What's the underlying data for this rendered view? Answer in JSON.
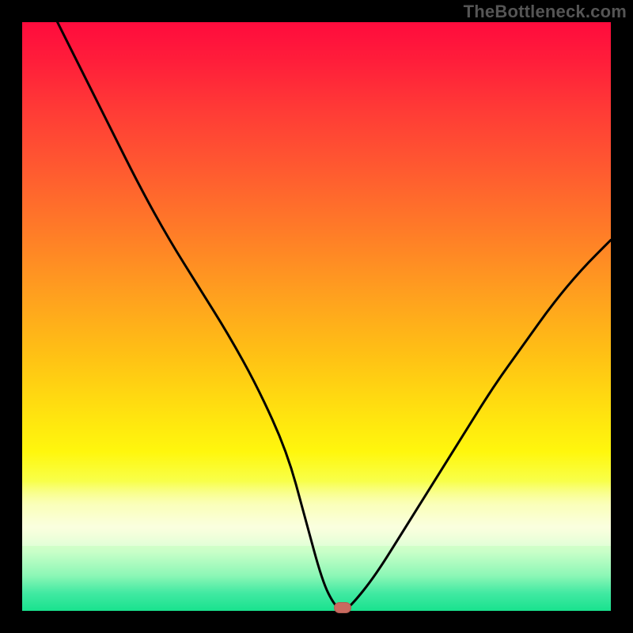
{
  "watermark": "TheBottleneck.com",
  "chart_data": {
    "type": "line",
    "title": "",
    "xlabel": "",
    "ylabel": "",
    "xlim": [
      0,
      100
    ],
    "ylim": [
      0,
      100
    ],
    "grid": false,
    "legend": false,
    "series": [
      {
        "name": "bottleneck-curve",
        "x": [
          6,
          10,
          15,
          20,
          25,
          30,
          35,
          40,
          45,
          48,
          51,
          53,
          54.5,
          56,
          60,
          65,
          70,
          75,
          80,
          85,
          90,
          95,
          100
        ],
        "values": [
          100,
          92,
          82,
          72,
          63,
          55,
          47,
          38,
          27,
          16,
          5,
          1,
          0,
          1,
          6,
          14,
          22,
          30,
          38,
          45,
          52,
          58,
          63
        ]
      }
    ],
    "markers": [
      {
        "name": "optimal-point",
        "x": 54.5,
        "y": 0,
        "color": "#c96a5f"
      }
    ],
    "background_gradient_stops_pct_from_top": {
      "red": 0,
      "orange": 40,
      "yellow": 70,
      "pale": 83,
      "green": 100
    }
  },
  "marker_color": "#c96a5f"
}
